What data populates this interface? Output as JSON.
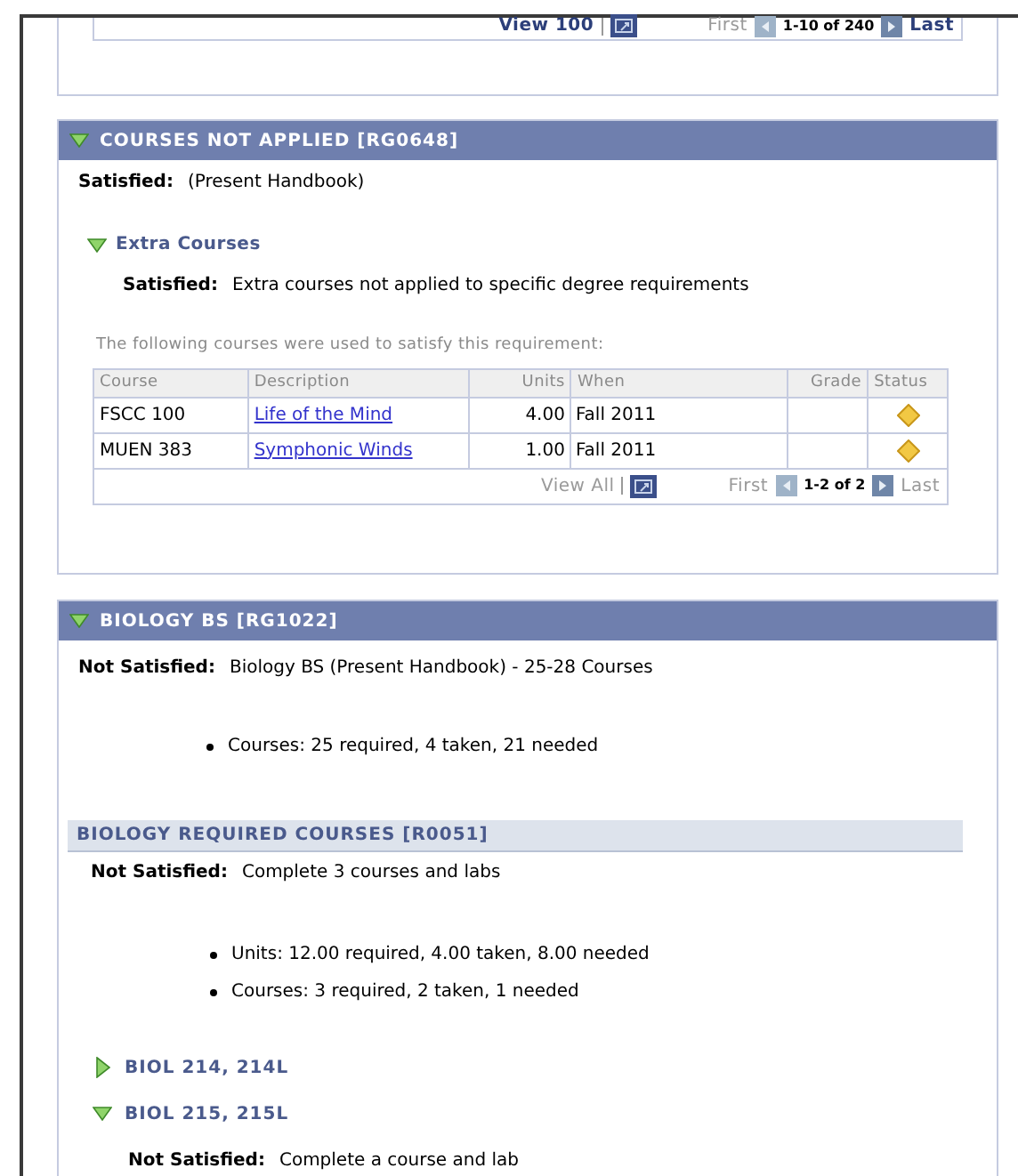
{
  "top_pager": {
    "links": [
      {
        "label": "View 100",
        "kind": "view",
        "disabled": false
      },
      {
        "label": "First",
        "kind": "first",
        "disabled": true
      },
      {
        "label": "Last",
        "kind": "last",
        "disabled": false
      }
    ],
    "range": "1-10 of 240"
  },
  "sections": [
    {
      "title": "COURSES NOT APPLIED [RG0648]",
      "expanded": true,
      "status_label": "Satisfied:",
      "status_text": "(Present Handbook)",
      "requirements": [
        {
          "title": "Extra Courses",
          "expanded": true,
          "status_label": "Satisfied:",
          "status_text": "Extra courses not applied to specific degree requirements",
          "caption": "The following courses were used to satisfy this requirement:",
          "table": {
            "columns": [
              "Course",
              "Description",
              "Units",
              "When",
              "Grade",
              "Status"
            ],
            "rows": [
              {
                "course": "FSCC 100",
                "description": "Life of the Mind",
                "units": "4.00",
                "when": "Fall 2011"
              },
              {
                "course": "MUEN 383",
                "description": "Symphonic Winds",
                "units": "1.00",
                "when": "Fall 2011"
              }
            ],
            "pager": {
              "links": [
                {
                  "label": "View All",
                  "kind": "view",
                  "disabled": true
                },
                {
                  "label": "First",
                  "kind": "first",
                  "disabled": true
                },
                {
                  "label": "Last",
                  "kind": "last",
                  "disabled": true
                }
              ],
              "range": "1-2 of 2"
            }
          }
        }
      ]
    },
    {
      "title": "BIOLOGY BS [RG1022]",
      "expanded": true,
      "status_label": "Not Satisfied:",
      "status_text": "Biology BS (Present Handbook) - 25-28 Courses",
      "bullets": [
        "Courses: 25 required, 4 taken, 21 needed"
      ],
      "subsection": {
        "title": "BIOLOGY REQUIRED COURSES [R0051]",
        "status_label": "Not Satisfied:",
        "status_text": "Complete 3 courses and labs",
        "bullets": [
          "Units: 12.00 required, 4.00 taken, 8.00 needed",
          "Courses: 3 required, 2 taken, 1 needed"
        ],
        "groups": [
          {
            "title": "BIOL 214, 214L",
            "expanded": false
          },
          {
            "title": "BIOL 215, 215L",
            "expanded": true,
            "status_label": "Not Satisfied:",
            "status_text": "Complete a course and lab"
          }
        ]
      }
    }
  ]
}
